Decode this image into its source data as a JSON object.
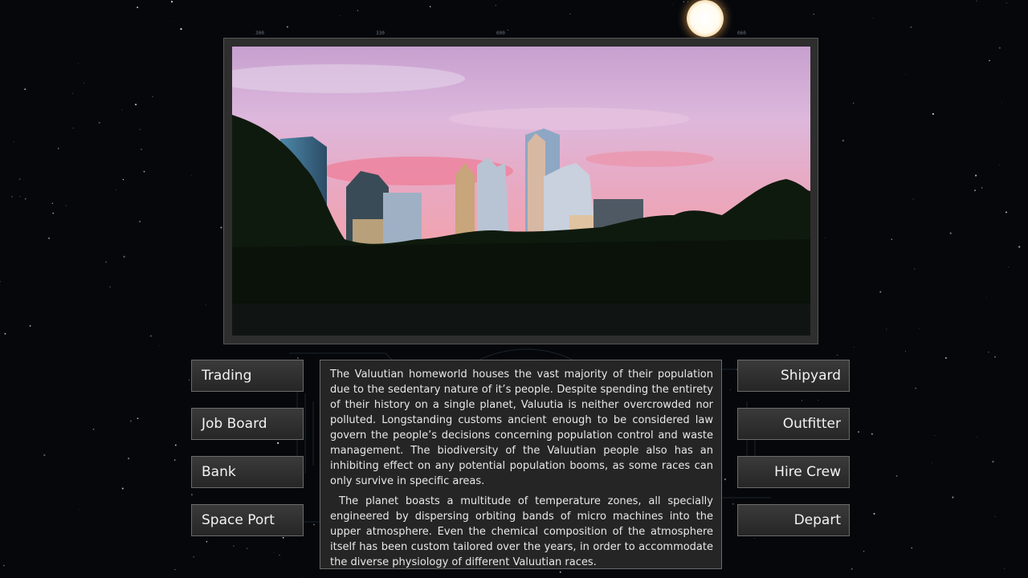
{
  "colors": {
    "background": "#05070b",
    "button_bg": "#2e2e2e",
    "button_border": "#6a6a6a",
    "text": "#f2f2f2"
  },
  "scene": {
    "image": "city-skyline-at-sunset"
  },
  "left_menu": [
    {
      "label": "Trading"
    },
    {
      "label": "Job Board"
    },
    {
      "label": "Bank"
    },
    {
      "label": "Space Port"
    }
  ],
  "right_menu": [
    {
      "label": "Shipyard"
    },
    {
      "label": "Outfitter"
    },
    {
      "label": "Hire Crew"
    },
    {
      "label": "Depart"
    }
  ],
  "description": {
    "paragraphs": [
      "The Valuutian homeworld houses the vast majority of their population due to the sedentary nature of it’s people. Despite spending the entirety of their history on a single planet, Valuutia is neither overcrowded nor polluted. Longstanding customs ancient enough to be considered law govern the people’s decisions concerning population control and waste management. The biodiversity of the Valuutian people also has an inhibiting effect on any potential population booms, as some races can only survive in specific areas.",
      "The planet boasts a multitude of temperature zones, all specially engineered by dispersing orbiting bands of micro machines into the upper atmosphere. Even the chemical composition of the atmosphere itself has been custom tailored over the years, in order to accommodate the diverse physiology of different Valuutian races."
    ]
  }
}
